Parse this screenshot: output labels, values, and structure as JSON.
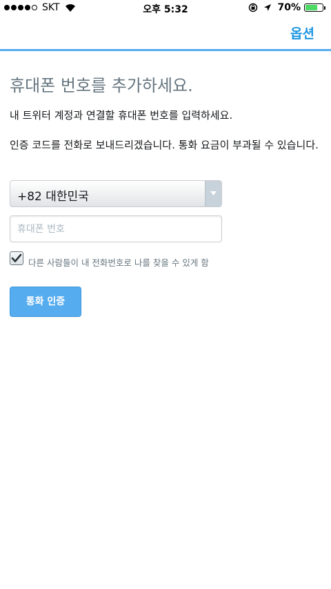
{
  "status_bar": {
    "carrier": "SKT",
    "time": "오후 5:32",
    "battery_percent": "70%",
    "battery_level": 0.7,
    "signal_bars_filled": 4,
    "signal_bars_total": 5
  },
  "nav": {
    "options_label": "옵션"
  },
  "main": {
    "title": "휴대폰 번호를 추가하세요.",
    "instruction": "내 트위터 계정과 연결할 휴대폰 번호를 입력하세요.",
    "notice": "인증 코드를 전화로 보내드리겠습니다. 통화 요금이 부과될 수 있습니다.",
    "country_select": {
      "selected": "+82 대한민국"
    },
    "phone_input": {
      "placeholder": "휴대폰 번호",
      "value": ""
    },
    "discoverable_checkbox": {
      "label": "다른 사람들이 내 전화번호로 나를 찾을 수 있게 함",
      "checked": true
    },
    "call_button_label": "통화 인증"
  },
  "colors": {
    "accent": "#1b95e0",
    "button": "#55acee",
    "rule": "#55acee",
    "battery": "#4cd964"
  }
}
